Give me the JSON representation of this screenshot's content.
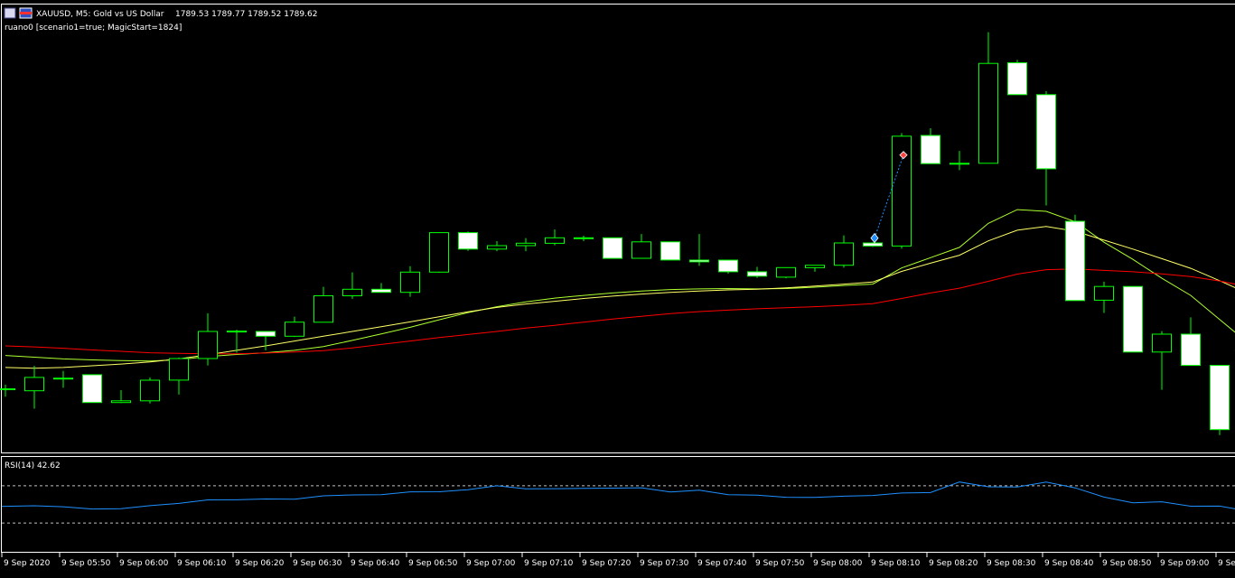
{
  "window": {
    "symbol_title": "XAUUSD, M5:  Gold vs US Dollar",
    "ohlc": "1789.53 1789.77 1789.52 1789.62",
    "ea_label": "ruano0 [scenario1=true; MagicStart=1824]"
  },
  "rsi": {
    "label": "RSI(14) 42.62"
  },
  "colors": {
    "background": "#000000",
    "grid_border": "#ffffff",
    "bull_border": "#00ff00",
    "bear_body": "#ffffff",
    "ma_fast": "#adff2f",
    "ma_mid": "#ffff66",
    "ma_slow": "#ff0000",
    "rsi_line": "#1e90ff",
    "rsi_levels": "#c0c0c0",
    "buy_arrow": "#1e90ff",
    "sell_arrow": "#ff4040",
    "trade_link": "#1e90ff"
  },
  "chart_data": [
    {
      "type": "candlestick",
      "timeframe": "M5",
      "ylim": [
        1786.5,
        1799.5
      ],
      "x_tick_labels": [
        "9 Sep 2020",
        "9 Sep 05:50",
        "9 Sep 06:00",
        "9 Sep 06:10",
        "9 Sep 06:20",
        "9 Sep 06:30",
        "9 Sep 06:40",
        "9 Sep 06:50",
        "9 Sep 07:00",
        "9 Sep 07:10",
        "9 Sep 07:20",
        "9 Sep 07:30",
        "9 Sep 07:40",
        "9 Sep 07:50",
        "9 Sep 08:00",
        "9 Sep 08:10",
        "9 Sep 08:20",
        "9 Sep 08:30",
        "9 Sep 08:40",
        "9 Sep 08:50",
        "9 Sep 09:00",
        "9 Sep"
      ],
      "candles": [
        {
          "o": 1788.33,
          "h": 1788.45,
          "l": 1788.1,
          "c": 1788.33
        },
        {
          "o": 1788.27,
          "h": 1789.0,
          "l": 1787.75,
          "c": 1788.66
        },
        {
          "o": 1788.64,
          "h": 1788.85,
          "l": 1788.36,
          "c": 1788.64
        },
        {
          "o": 1788.74,
          "h": 1788.74,
          "l": 1787.93,
          "c": 1787.93
        },
        {
          "o": 1787.93,
          "h": 1788.29,
          "l": 1787.91,
          "c": 1787.98
        },
        {
          "o": 1787.98,
          "h": 1788.66,
          "l": 1787.9,
          "c": 1788.58
        },
        {
          "o": 1788.58,
          "h": 1789.24,
          "l": 1788.16,
          "c": 1789.21
        },
        {
          "o": 1789.21,
          "h": 1790.53,
          "l": 1789.01,
          "c": 1790.0
        },
        {
          "o": 1790.01,
          "h": 1790.05,
          "l": 1789.38,
          "c": 1790.01
        },
        {
          "o": 1790.0,
          "h": 1790.0,
          "l": 1789.45,
          "c": 1789.86
        },
        {
          "o": 1789.86,
          "h": 1790.43,
          "l": 1789.84,
          "c": 1790.27
        },
        {
          "o": 1790.27,
          "h": 1791.3,
          "l": 1790.27,
          "c": 1791.04
        },
        {
          "o": 1791.04,
          "h": 1791.72,
          "l": 1790.95,
          "c": 1791.23
        },
        {
          "o": 1791.23,
          "h": 1791.41,
          "l": 1791.14,
          "c": 1791.14
        },
        {
          "o": 1791.14,
          "h": 1791.9,
          "l": 1791.01,
          "c": 1791.73
        },
        {
          "o": 1791.73,
          "h": 1792.88,
          "l": 1791.71,
          "c": 1792.88
        },
        {
          "o": 1792.88,
          "h": 1792.91,
          "l": 1792.35,
          "c": 1792.4
        },
        {
          "o": 1792.4,
          "h": 1792.63,
          "l": 1792.34,
          "c": 1792.5
        },
        {
          "o": 1792.5,
          "h": 1792.72,
          "l": 1792.34,
          "c": 1792.57
        },
        {
          "o": 1792.57,
          "h": 1792.97,
          "l": 1792.51,
          "c": 1792.73
        },
        {
          "o": 1792.73,
          "h": 1792.79,
          "l": 1792.63,
          "c": 1792.73
        },
        {
          "o": 1792.73,
          "h": 1792.73,
          "l": 1792.13,
          "c": 1792.13
        },
        {
          "o": 1792.13,
          "h": 1792.84,
          "l": 1792.13,
          "c": 1792.61
        },
        {
          "o": 1792.61,
          "h": 1792.61,
          "l": 1792.08,
          "c": 1792.08
        },
        {
          "o": 1792.08,
          "h": 1792.84,
          "l": 1791.91,
          "c": 1792.03
        },
        {
          "o": 1792.08,
          "h": 1792.08,
          "l": 1791.68,
          "c": 1791.74
        },
        {
          "o": 1791.74,
          "h": 1791.88,
          "l": 1791.56,
          "c": 1791.61
        },
        {
          "o": 1791.58,
          "h": 1791.86,
          "l": 1791.55,
          "c": 1791.86
        },
        {
          "o": 1791.86,
          "h": 1791.93,
          "l": 1791.74,
          "c": 1791.93
        },
        {
          "o": 1791.93,
          "h": 1792.8,
          "l": 1791.86,
          "c": 1792.58
        },
        {
          "o": 1792.58,
          "h": 1792.6,
          "l": 1792.46,
          "c": 1792.49
        },
        {
          "o": 1792.49,
          "h": 1795.78,
          "l": 1792.41,
          "c": 1795.69
        },
        {
          "o": 1795.71,
          "h": 1795.92,
          "l": 1794.89,
          "c": 1794.89
        },
        {
          "o": 1794.9,
          "h": 1795.26,
          "l": 1794.7,
          "c": 1794.9
        },
        {
          "o": 1794.9,
          "h": 1798.72,
          "l": 1794.9,
          "c": 1797.81
        },
        {
          "o": 1797.83,
          "h": 1797.91,
          "l": 1796.9,
          "c": 1796.9
        },
        {
          "o": 1796.9,
          "h": 1797.0,
          "l": 1793.67,
          "c": 1794.74
        },
        {
          "o": 1793.21,
          "h": 1793.4,
          "l": 1790.9,
          "c": 1790.9
        },
        {
          "o": 1790.91,
          "h": 1791.45,
          "l": 1790.54,
          "c": 1791.31
        },
        {
          "o": 1791.31,
          "h": 1791.31,
          "l": 1789.4,
          "c": 1789.4
        },
        {
          "o": 1789.4,
          "h": 1790.01,
          "l": 1788.3,
          "c": 1789.92
        },
        {
          "o": 1789.92,
          "h": 1790.41,
          "l": 1789.01,
          "c": 1789.01
        },
        {
          "o": 1789.01,
          "h": 1789.01,
          "l": 1786.98,
          "c": 1787.14
        },
        {
          "o": 1787.14,
          "h": 1787.14,
          "l": 1786.5,
          "c": 1786.7
        }
      ],
      "series": [
        {
          "key": "ma_fast",
          "values": [
            1789.3,
            1789.25,
            1789.2,
            1789.17,
            1789.15,
            1789.14,
            1789.18,
            1789.27,
            1789.33,
            1789.38,
            1789.45,
            1789.56,
            1789.74,
            1789.93,
            1790.12,
            1790.34,
            1790.55,
            1790.72,
            1790.86,
            1790.97,
            1791.05,
            1791.12,
            1791.18,
            1791.22,
            1791.24,
            1791.25,
            1791.24,
            1791.25,
            1791.29,
            1791.34,
            1791.38,
            1791.85,
            1792.15,
            1792.45,
            1793.15,
            1793.55,
            1793.5,
            1793.2,
            1792.6,
            1792.1,
            1791.55,
            1791.05,
            1790.35,
            1789.65
          ]
        },
        {
          "key": "ma_mid",
          "values": [
            1788.95,
            1788.93,
            1788.95,
            1789.0,
            1789.05,
            1789.11,
            1789.2,
            1789.32,
            1789.45,
            1789.58,
            1789.72,
            1789.86,
            1790.0,
            1790.14,
            1790.28,
            1790.43,
            1790.57,
            1790.7,
            1790.8,
            1790.88,
            1790.96,
            1791.03,
            1791.09,
            1791.14,
            1791.18,
            1791.21,
            1791.23,
            1791.27,
            1791.32,
            1791.38,
            1791.44,
            1791.75,
            1791.99,
            1792.22,
            1792.64,
            1792.95,
            1793.06,
            1792.92,
            1792.66,
            1792.4,
            1792.12,
            1791.84,
            1791.48,
            1791.1
          ]
        },
        {
          "key": "ma_slow",
          "values": [
            1789.58,
            1789.55,
            1789.51,
            1789.46,
            1789.42,
            1789.38,
            1789.36,
            1789.35,
            1789.35,
            1789.37,
            1789.4,
            1789.44,
            1789.52,
            1789.62,
            1789.72,
            1789.82,
            1789.91,
            1790.0,
            1790.1,
            1790.18,
            1790.27,
            1790.36,
            1790.44,
            1790.52,
            1790.58,
            1790.62,
            1790.66,
            1790.69,
            1790.72,
            1790.76,
            1790.81,
            1790.96,
            1791.12,
            1791.26,
            1791.46,
            1791.67,
            1791.8,
            1791.82,
            1791.78,
            1791.74,
            1791.68,
            1791.6,
            1791.47,
            1791.3
          ]
        }
      ],
      "trade": {
        "buy_index": 30,
        "buy_price": 1792.72,
        "sell_index": 31,
        "sell_price": 1795.14
      }
    },
    {
      "type": "line",
      "title": "RSI(14) 42.62",
      "ylim": [
        0,
        100
      ],
      "levels": [
        70,
        30
      ],
      "values": [
        48.0,
        48.5,
        47.5,
        45.0,
        45.3,
        48.6,
        51.1,
        54.9,
        55.0,
        55.8,
        55.5,
        59.2,
        60.2,
        60.4,
        63.5,
        63.6,
        65.8,
        70.0,
        66.7,
        66.9,
        67.3,
        67.5,
        67.9,
        63.4,
        65.2,
        60.5,
        60.0,
        57.7,
        57.5,
        58.8,
        59.6,
        62.2,
        62.7,
        74.1,
        68.9,
        68.6,
        74.1,
        67.8,
        57.9,
        51.7,
        52.8,
        48.1,
        48.2,
        42.62
      ]
    }
  ]
}
